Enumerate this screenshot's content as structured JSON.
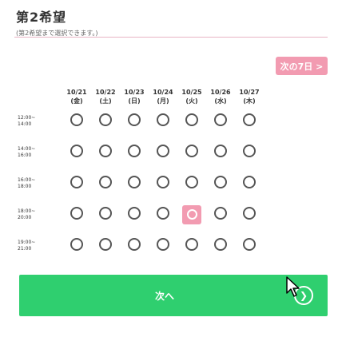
{
  "header": {
    "title": "第2希望",
    "subtitle": "(第2希望まで選択できます。)"
  },
  "next_button": {
    "label": "次の7日 >"
  },
  "dates": [
    {
      "date": "10/21",
      "day": "(金)"
    },
    {
      "date": "10/22",
      "day": "(土)"
    },
    {
      "date": "10/23",
      "day": "(日)"
    },
    {
      "date": "10/24",
      "day": "(月)"
    },
    {
      "date": "10/25",
      "day": "(火)"
    },
    {
      "date": "10/26",
      "day": "(水)"
    },
    {
      "date": "10/27",
      "day": "(木)"
    }
  ],
  "times": [
    {
      "top": "12:00~",
      "mid": "14:00",
      "bottom": "14:00"
    },
    {
      "top": "14:00~",
      "mid": "16:00",
      "bottom": "16:00"
    },
    {
      "top": "16:00~",
      "mid": "18:00",
      "bottom": "18:00"
    },
    {
      "top": "18:00~",
      "mid": "20:00",
      "bottom": "20:00"
    },
    {
      "top": "19:00~",
      "mid": "21:00",
      "bottom": "21:00"
    }
  ],
  "slots": [
    [
      "circle",
      "circle",
      "circle",
      "circle",
      "circle",
      "circle",
      "circle"
    ],
    [
      "circle",
      "circle",
      "circle",
      "circle",
      "circle",
      "circle",
      "circle"
    ],
    [
      "circle",
      "circle",
      "circle",
      "circle",
      "circle",
      "circle",
      "circle"
    ],
    [
      "circle",
      "circle",
      "circle",
      "circle",
      "selected",
      "circle",
      "circle"
    ],
    [
      "circle",
      "circle",
      "circle",
      "circle",
      "circle",
      "circle",
      "circle"
    ]
  ],
  "cta": {
    "label": "次へ"
  },
  "colors": {
    "accent": "#f29bb1",
    "cta": "#2fcf6f",
    "divider": "#e8b4c4"
  }
}
